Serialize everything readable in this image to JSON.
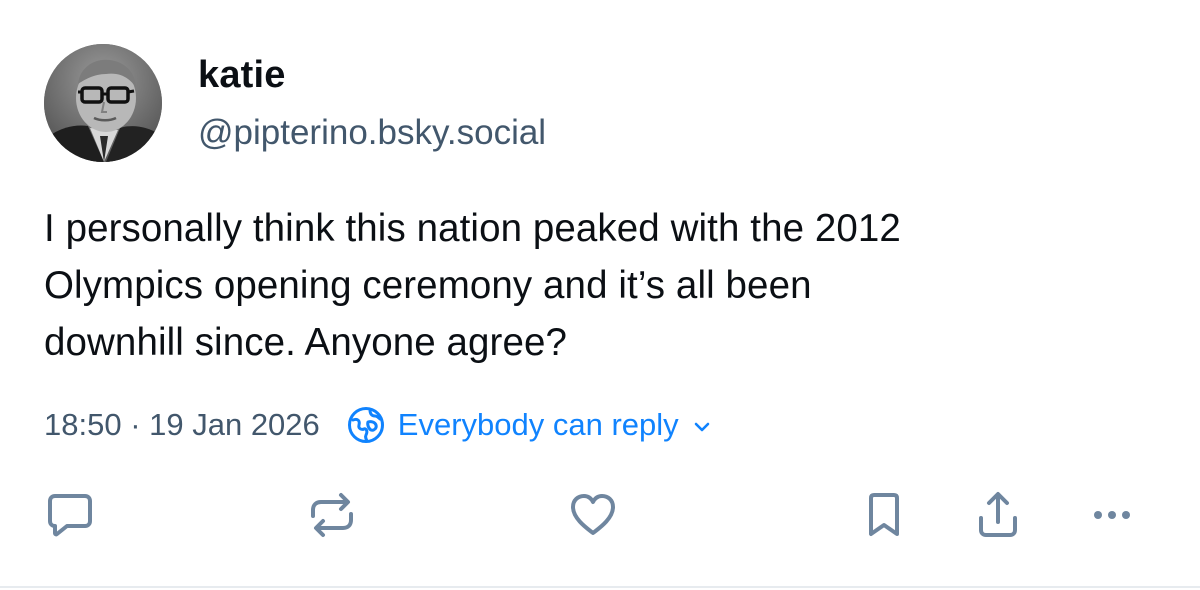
{
  "post": {
    "author": {
      "display_name": "katie",
      "handle": "@pipterino.bsky.social",
      "avatar": "avatar-photo"
    },
    "text_lines": [
      "I personally think this nation peaked with the 2012",
      "Olympics opening ceremony and it’s all been",
      "downhill since. Anyone agree?"
    ],
    "timestamp": "18:50 · 19 Jan 2026",
    "reply_setting": {
      "label": "Everybody can reply",
      "icon": "globe-icon",
      "dropdown_icon": "chevron-down-icon"
    },
    "actions": [
      {
        "name": "reply",
        "icon": "speech-bubble-icon"
      },
      {
        "name": "repost",
        "icon": "repost-icon"
      },
      {
        "name": "like",
        "icon": "heart-icon"
      },
      {
        "name": "bookmark",
        "icon": "bookmark-icon"
      },
      {
        "name": "share",
        "icon": "share-icon"
      },
      {
        "name": "more",
        "icon": "more-options-icon"
      }
    ]
  },
  "colors": {
    "text": "#0b0f14",
    "muted": "#42576c",
    "accent": "#1083fe",
    "icon": "#6f869f",
    "divider": "#e7ebef"
  }
}
